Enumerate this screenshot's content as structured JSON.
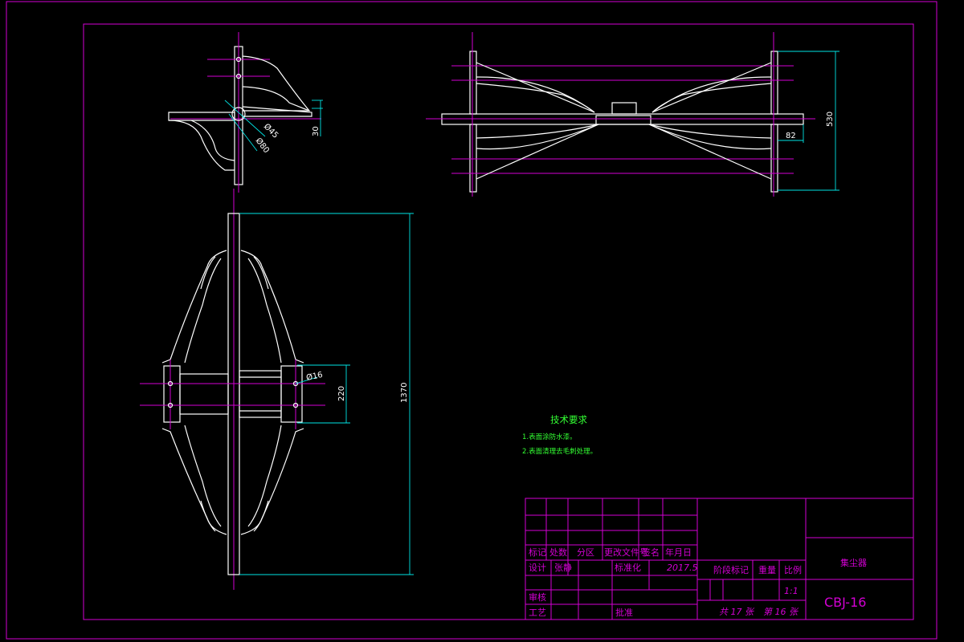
{
  "views": {
    "top_left": {
      "dim_height": "30",
      "dim_dia_small": "Ø45",
      "dim_dia_large": "Ø80"
    },
    "front_right": {
      "dim_width": "82",
      "dim_height": "530"
    },
    "main": {
      "dim_span": "220",
      "dim_total": "1370",
      "dim_hole": "Ø16"
    }
  },
  "tech_notes": {
    "title": "技术要求",
    "items": [
      "1.表面涂防水漆。",
      "2.表面清理去毛刺处理。"
    ]
  },
  "title_block": {
    "drawing_title": "集尘器",
    "drawing_number": "CBJ-16",
    "header_labels": [
      "标记",
      "处数",
      "分区",
      "更改文件号",
      "签名",
      "年月日"
    ],
    "design_label": "设计",
    "designer": "张静",
    "standardize_label": "标准化",
    "date": "2017.5",
    "stage_mark_label": "阶段标记",
    "weight_label": "重量",
    "scale_label": "比例",
    "scale_value": "1:1",
    "review_label": "审核",
    "process_label": "工艺",
    "approve_label": "批准",
    "total_sheets": "共 17 张",
    "sheet_no": "第 16 张"
  },
  "colors": {
    "background": "#000000",
    "frame": "#d400d4",
    "geometry": "#ffffff",
    "dimension": "#00e5e5",
    "notes": "#33ff33"
  }
}
